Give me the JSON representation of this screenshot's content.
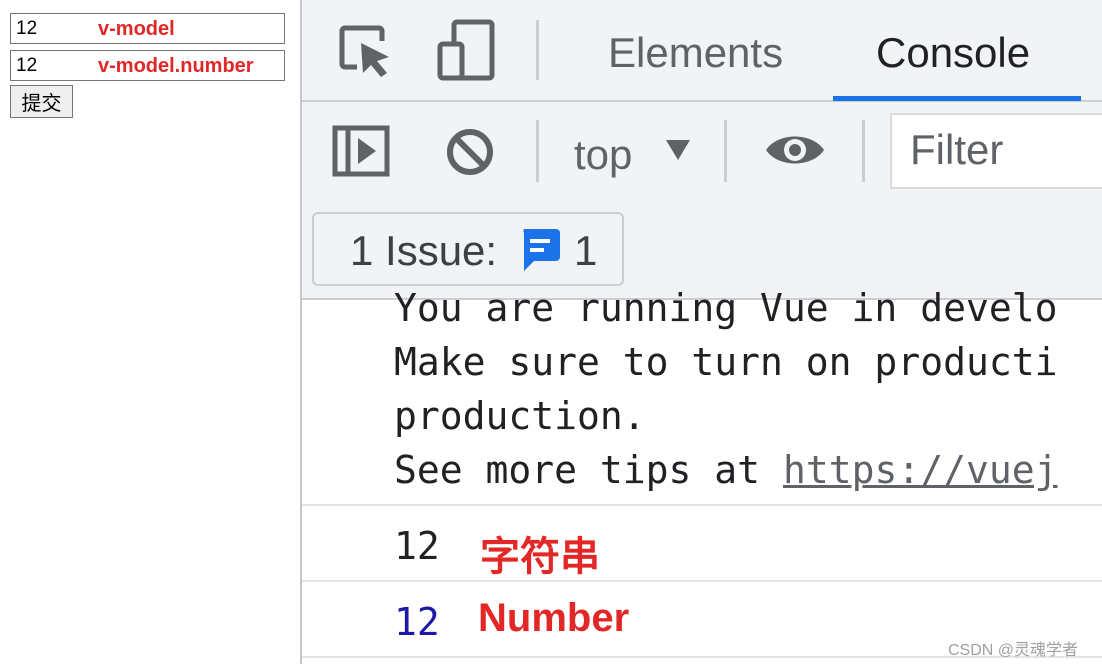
{
  "page": {
    "input1": {
      "value": "12",
      "note": "v-model"
    },
    "input2": {
      "value": "12",
      "note": "v-model.number"
    },
    "submit_label": "提交"
  },
  "devtools": {
    "tabs": [
      {
        "label": "Elements",
        "active": false
      },
      {
        "label": "Console",
        "active": true
      }
    ],
    "toolbar": {
      "context": "top",
      "filter_placeholder": "Filter"
    },
    "issues": {
      "label": "1 Issue:",
      "count": "1"
    },
    "console": {
      "vue_message": [
        "You are running Vue in develo",
        "Make sure to turn on producti",
        "production.",
        "See more tips at "
      ],
      "vue_link": "https://vuej",
      "logs": [
        {
          "value": "12",
          "value_color": "#202124",
          "note": "字符串"
        },
        {
          "value": "12",
          "value_color": "#1a1aa6",
          "note": "Number"
        }
      ]
    }
  },
  "colors": {
    "accent": "#1a73e8",
    "annotation": "#e32727"
  },
  "watermark": "CSDN @灵魂学者"
}
